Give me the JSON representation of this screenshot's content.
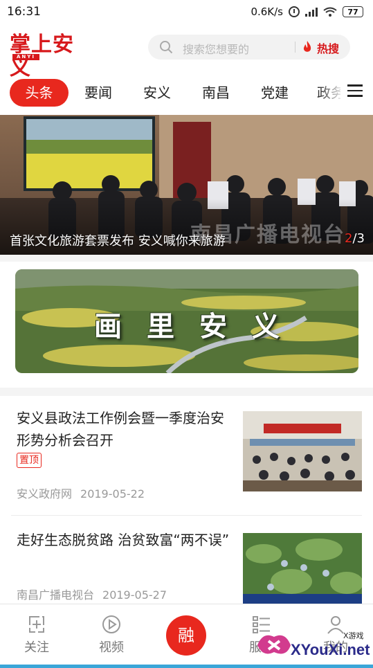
{
  "status_bar": {
    "time": "16:31",
    "net_speed": "0.6K/s",
    "battery": "77"
  },
  "header": {
    "logo_text": "掌上安义",
    "logo_sub": "ANYI",
    "search_placeholder": "搜索您想要的",
    "hot_label": "热搜"
  },
  "tabs": [
    {
      "label": "头条",
      "active": true
    },
    {
      "label": "要闻",
      "active": false
    },
    {
      "label": "安义",
      "active": false
    },
    {
      "label": "南昌",
      "active": false
    },
    {
      "label": "党建",
      "active": false
    },
    {
      "label": "政务",
      "active": false
    }
  ],
  "banner": {
    "caption": "首张文化旅游套票发布 安义喊你来旅游",
    "page_current": "2",
    "page_total": "/3",
    "watermark": "南昌广播电视台"
  },
  "promo": {
    "title": "画里安义"
  },
  "news": [
    {
      "title": "安义县政法工作例会暨一季度治安形势分析会召开",
      "badge": "置顶",
      "source": "安义政府网",
      "date": "2019-05-22"
    },
    {
      "title": "走好生态脱贫路 治贫致富“两不误”",
      "badge": "",
      "source": "南昌广播电视台",
      "date": "2019-05-27"
    }
  ],
  "bottom_nav": [
    {
      "label": "关注",
      "icon": "follow-icon"
    },
    {
      "label": "视频",
      "icon": "video-play-icon"
    },
    {
      "label": "融",
      "icon": "fusion-button"
    },
    {
      "label": "服务",
      "icon": "service-list-icon"
    },
    {
      "label": "我的",
      "icon": "profile-icon"
    }
  ],
  "watermark": {
    "site": "XYouXi.net",
    "small": "X游戏"
  },
  "colors": {
    "accent": "#e8281e",
    "logo_red": "#d7191c",
    "meta_gray": "#999999"
  }
}
